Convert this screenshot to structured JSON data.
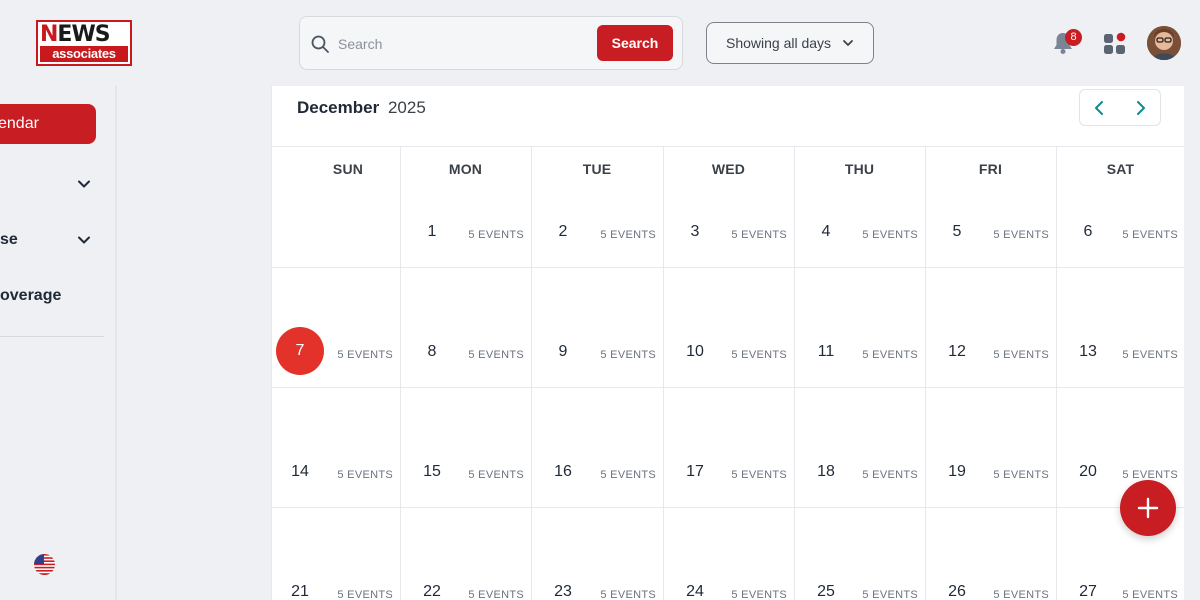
{
  "brand": {
    "logo_top_n": "N",
    "logo_top_rest": "EWS",
    "logo_bottom": "associates",
    "accent": "#c81d22"
  },
  "search": {
    "placeholder": "Search",
    "value": "",
    "button_label": "Search"
  },
  "filter": {
    "label": "Showing all days"
  },
  "notifications": {
    "count": "8"
  },
  "sidebar": {
    "items": [
      {
        "label": "endar",
        "active": true
      },
      {
        "label": "",
        "expandable": true
      },
      {
        "label": "se",
        "expandable": true
      },
      {
        "label": "overage",
        "expandable": false
      }
    ]
  },
  "calendar": {
    "month": "December",
    "year": "2025",
    "weekdays": [
      "SUN",
      "MON",
      "TUE",
      "WED",
      "THU",
      "FRI",
      "SAT"
    ],
    "today": "7",
    "weeks": [
      [
        null,
        {
          "d": "1",
          "e": "5 EVENTS"
        },
        {
          "d": "2",
          "e": "5 EVENTS"
        },
        {
          "d": "3",
          "e": "5 EVENTS"
        },
        {
          "d": "4",
          "e": "5 EVENTS"
        },
        {
          "d": "5",
          "e": "5 EVENTS"
        },
        {
          "d": "6",
          "e": "5 EVENTS"
        }
      ],
      [
        {
          "d": "7",
          "e": "5 EVENTS"
        },
        {
          "d": "8",
          "e": "5 EVENTS"
        },
        {
          "d": "9",
          "e": "5 EVENTS"
        },
        {
          "d": "10",
          "e": "5 EVENTS"
        },
        {
          "d": "11",
          "e": "5 EVENTS"
        },
        {
          "d": "12",
          "e": "5 EVENTS"
        },
        {
          "d": "13",
          "e": "5 EVENTS"
        }
      ],
      [
        {
          "d": "14",
          "e": "5 EVENTS"
        },
        {
          "d": "15",
          "e": "5 EVENTS"
        },
        {
          "d": "16",
          "e": "5 EVENTS"
        },
        {
          "d": "17",
          "e": "5 EVENTS"
        },
        {
          "d": "18",
          "e": "5 EVENTS"
        },
        {
          "d": "19",
          "e": "5 EVENTS"
        },
        {
          "d": "20",
          "e": "5 EVENTS"
        }
      ],
      [
        {
          "d": "21",
          "e": "5 EVENTS"
        },
        {
          "d": "22",
          "e": "5 EVENTS"
        },
        {
          "d": "23",
          "e": "5 EVENTS"
        },
        {
          "d": "24",
          "e": "5 EVENTS"
        },
        {
          "d": "25",
          "e": "5 EVENTS"
        },
        {
          "d": "26",
          "e": "5 EVENTS"
        },
        {
          "d": "27",
          "e": "5 EVENTS"
        }
      ]
    ]
  },
  "icons": {
    "search": "search-icon",
    "chevron": "chevron-down-icon",
    "bell": "bell-icon",
    "apps": "apps-grid-icon",
    "prev": "chevron-left-icon",
    "next": "chevron-right-icon",
    "add": "plus-icon",
    "flag": "us-flag-icon"
  }
}
